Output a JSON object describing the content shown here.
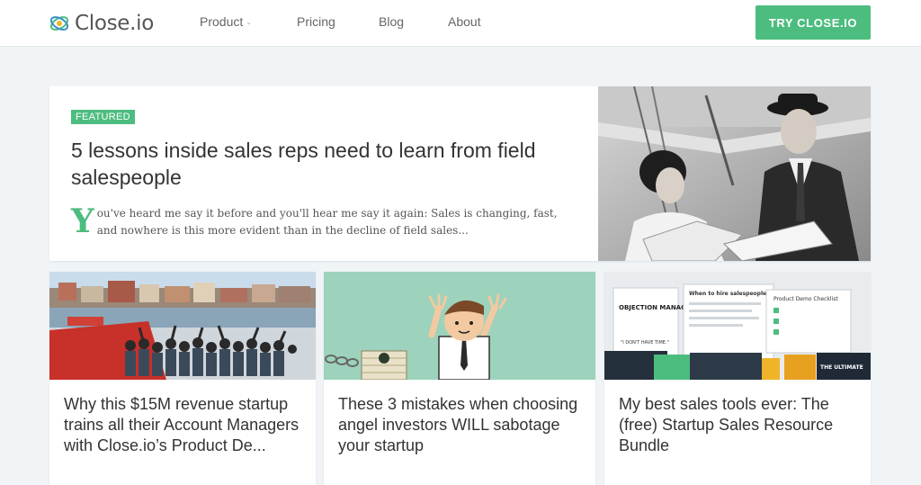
{
  "header": {
    "logo_text": "Close.io",
    "nav": {
      "product": "Product",
      "pricing": "Pricing",
      "blog": "Blog",
      "about": "About"
    },
    "cta_label": "TRY CLOSE.IO"
  },
  "featured": {
    "badge": "FEATURED",
    "title": "5 lessons inside sales reps need to learn from field salespeople",
    "excerpt_initial": "Y",
    "excerpt_rest": "ou've heard me say it before and you'll hear me say it again: Sales is changing, fast, and nowhere is this more evident than in the decline of field sales..."
  },
  "cards": [
    {
      "title": "Why this $15M revenue startup trains all their Account Managers with Close.io’s Product De..."
    },
    {
      "title": "These 3 mistakes when choosing angel investors WILL sabotage your startup"
    },
    {
      "title": "My best sales tools ever: The (free) Startup Sales Resource Bundle"
    }
  ],
  "colors": {
    "accent": "#4dbd7f",
    "background": "#f1f4f6"
  },
  "image_texts": {
    "card3": {
      "doc1": "OBJECTION MANAGEMENT DOCUMENT",
      "doc2": "When to hire salespeople?",
      "doc3": "Product Demo Checklist",
      "doc4": "THE ULTIMATE",
      "quote": "\"I DON'T HAVE TIME.\""
    }
  }
}
